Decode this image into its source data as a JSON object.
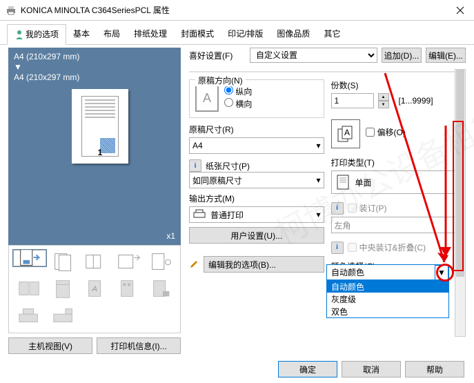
{
  "window": {
    "title": "KONICA MINOLTA C364SeriesPCL 属性"
  },
  "tabs": [
    "我的选项",
    "基本",
    "布局",
    "排纸处理",
    "封面模式",
    "印记/排版",
    "图像品质",
    "其它"
  ],
  "fav": {
    "label": "喜好设置(F)",
    "value": "自定义设置",
    "add": "追加(D)...",
    "edit": "编辑(E)..."
  },
  "preview": {
    "line1": "A4 (210x297 mm)",
    "arrow": "▼",
    "line2": "A4 (210x297 mm)",
    "pagenum": "1",
    "zoom": "x1"
  },
  "leftButtons": {
    "main": "主机视图(V)",
    "info": "打印机信息(I)..."
  },
  "orient": {
    "group": "原稿方向(N)",
    "icon": "A",
    "portrait": "纵向",
    "landscape": "横向"
  },
  "size": {
    "label": "原稿尺寸(R)",
    "value": "A4",
    "paperLabel": "纸张尺寸(P)",
    "paperValue": "如同原稿尺寸",
    "outLabel": "输出方式(M)",
    "outValue": "普通打印"
  },
  "userBtn": "用户设置(U)...",
  "copies": {
    "label": "份数(S)",
    "value": "1",
    "range": "[1...9999]",
    "offset": "偏移(O)"
  },
  "printType": {
    "label": "打印类型(T)",
    "value": "单面"
  },
  "bind": {
    "label": "装订(P)",
    "value": "左角",
    "fold": "中央装订&折叠(C)"
  },
  "color": {
    "label": "颜色选择(C)",
    "value": "自动颜色",
    "options": [
      "自动颜色",
      "灰度级",
      "双色"
    ]
  },
  "editOpts": "编辑我的选项(B)...",
  "footer": {
    "ok": "确定",
    "cancel": "取消",
    "help": "帮助"
  },
  "icons": {
    "lock": "▼",
    "info": "i"
  }
}
